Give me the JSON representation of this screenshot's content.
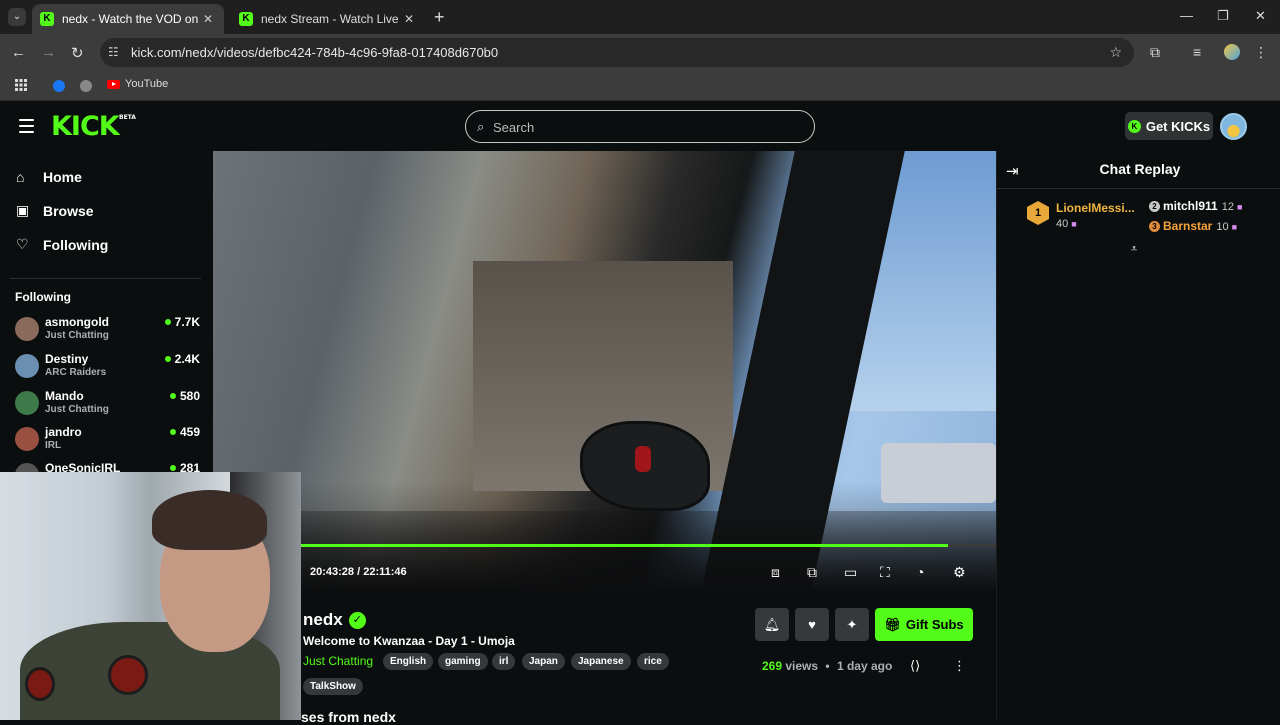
{
  "browser": {
    "tabs": [
      {
        "title": "nedx - Watch the VOD on Kick",
        "active": true
      },
      {
        "title": "nedx Stream - Watch Live on Kick",
        "active": false
      }
    ],
    "url": "kick.com/nedx/videos/defbc424-784b-4c96-9fa8-017408d670b0",
    "bookmarks": [
      "YouTube"
    ]
  },
  "header": {
    "logo": "KICK",
    "logo_badge": "BETA",
    "search_placeholder": "Search",
    "get_kicks": "Get KICKs"
  },
  "sidebar": {
    "nav": [
      {
        "label": "Home",
        "icon": "home-icon"
      },
      {
        "label": "Browse",
        "icon": "browse-icon"
      },
      {
        "label": "Following",
        "icon": "heart-icon"
      }
    ],
    "following_heading": "Following",
    "following": [
      {
        "name": "asmongold",
        "category": "Just Chatting",
        "viewers": "7.7K",
        "avatar_color": "#8a6a5a"
      },
      {
        "name": "Destiny",
        "category": "ARC Raiders",
        "viewers": "2.4K",
        "avatar_color": "#6a8fb0"
      },
      {
        "name": "Mando",
        "category": "Just Chatting",
        "viewers": "580",
        "avatar_color": "#3f7a4a"
      },
      {
        "name": "jandro",
        "category": "IRL",
        "viewers": "459",
        "avatar_color": "#9a5040"
      },
      {
        "name": "OneSonicIRL",
        "category": "",
        "viewers": "281",
        "avatar_color": "#555"
      }
    ]
  },
  "player": {
    "current_time": "20:43:28",
    "separator": "/",
    "duration": "22:11:46",
    "progress_fraction": 0.931
  },
  "video_info": {
    "streamer": "nedx",
    "title": "Welcome to Kwanzaa - Day 1 - Umoja",
    "category": "Just Chatting",
    "tags": [
      "English",
      "gaming",
      "irl",
      "Japan",
      "Japanese",
      "rice",
      "TalkShow"
    ],
    "views_count": "269",
    "views_label": "views",
    "dot": "•",
    "age": "1 day ago",
    "gift_subs": "Gift Subs",
    "more_from": "ses from nedx"
  },
  "chat": {
    "title": "Chat Replay",
    "leaderboard": [
      {
        "rank": "1",
        "name": "LionelMessi...",
        "count": "40"
      },
      {
        "rank": "2",
        "name": "mitchl911",
        "count": "12"
      },
      {
        "rank": "3",
        "name": "Barnstar",
        "count": "10"
      }
    ]
  },
  "colors": {
    "accent": "#53fc18",
    "gold": "#f0b640",
    "bronze": "#f5a23a"
  }
}
